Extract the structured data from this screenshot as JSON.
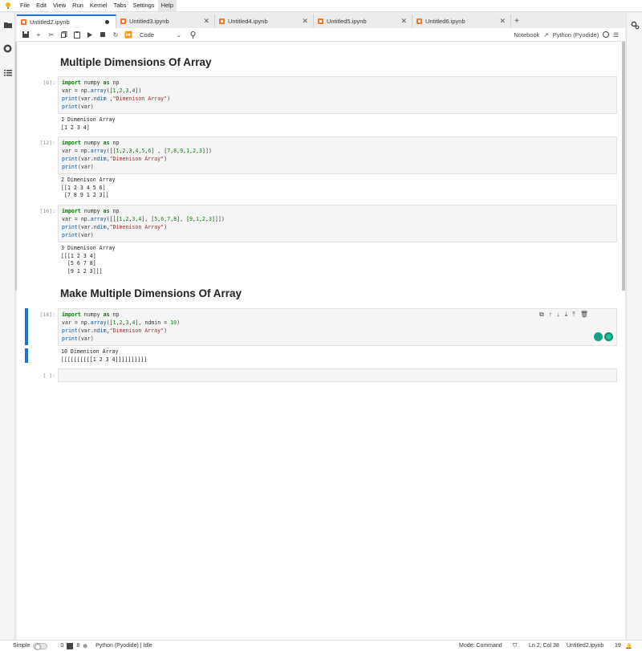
{
  "menubar": {
    "items": [
      "File",
      "Edit",
      "View",
      "Run",
      "Kernel",
      "Tabs",
      "Settings",
      "Help"
    ],
    "active": "Help"
  },
  "tabs": [
    {
      "label": "Untitled2.ipynb",
      "active": true,
      "dirty": true
    },
    {
      "label": "Untitled3.ipynb",
      "active": false
    },
    {
      "label": "Untitled4.ipynb",
      "active": false
    },
    {
      "label": "Untitled5.ipynb",
      "active": false
    },
    {
      "label": "Untitled6.ipynb",
      "active": false
    }
  ],
  "toolbar": {
    "cell_type": "Code",
    "notebook_label": "Notebook",
    "kernel_label": "Python (Pyodide)"
  },
  "cells": {
    "h1": "Multiple Dimensions Of Array",
    "c1": {
      "prompt": "[8]:",
      "output": "1 Dimenison Array\n[1 2 3 4]"
    },
    "c2": {
      "prompt": "[12]:",
      "output": "2 Dimenison Array\n[[1 2 3 4 5 6]\n [7 8 9 1 2 3]]"
    },
    "c3": {
      "prompt": "[10]:",
      "output": "3 Dimenison Array\n[[[1 2 3 4]\n  [5 6 7 8]\n  [9 1 2 3]]]"
    },
    "h2": "Make Multiple Dimensions Of Array",
    "c4": {
      "prompt": "[18]:",
      "output": "10 Dimenison Array\n[[[[[[[[[[1 2 3 4]]]]]]]]]]"
    },
    "c5": {
      "prompt": "[ ]:"
    }
  },
  "statusbar": {
    "mode_label": "Simple",
    "count_a": "0",
    "count_b": "8",
    "kernel_status": "Python (Pyodide) | Idle",
    "mode": "Mode: Command",
    "position": "Ln 2, Col 38",
    "filename": "Untitled2.ipynb",
    "notifications": "19"
  },
  "colors": {
    "accent": "#1976d2",
    "notebook_icon": "#f37726"
  }
}
